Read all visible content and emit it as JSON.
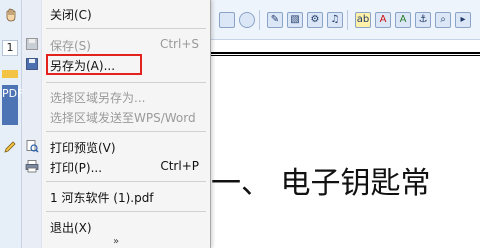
{
  "left_panel": {
    "page_number": "1",
    "label": "PDF"
  },
  "toolbar": {
    "icons": [
      "rectangle-icon",
      "ellipse-icon",
      "pencil-icon",
      "image-icon",
      "stamp-icon",
      "audio-icon",
      "highlight-icon",
      "text-color-icon",
      "font-color-icon",
      "anchor-icon",
      "search-icon"
    ]
  },
  "menu": {
    "items": [
      {
        "label": "关闭(C)",
        "shortcut": "",
        "disabled": false
      },
      {
        "label": "保存(S)",
        "shortcut": "Ctrl+S",
        "disabled": true
      },
      {
        "label": "另存为(A)...",
        "shortcut": "",
        "disabled": false
      },
      {
        "label": "选择区域另存为...",
        "shortcut": "",
        "disabled": true
      },
      {
        "label": "选择区域发送至WPS/Word",
        "shortcut": "",
        "disabled": true
      },
      {
        "label": "打印预览(V)",
        "shortcut": "",
        "disabled": false
      },
      {
        "label": "打印(P)...",
        "shortcut": "Ctrl+P",
        "disabled": false
      },
      {
        "label": "1 河东软件 (1).pdf",
        "shortcut": "",
        "disabled": false
      },
      {
        "label": "退出(X)",
        "shortcut": "",
        "disabled": false
      }
    ],
    "more_indicator": "»"
  },
  "document": {
    "heading": "一、 电子钥匙常"
  },
  "colors": {
    "menu_bg": "#f5f5f5",
    "toolbar_bg": "#eef4fb",
    "highlight_border": "#e3221f"
  }
}
